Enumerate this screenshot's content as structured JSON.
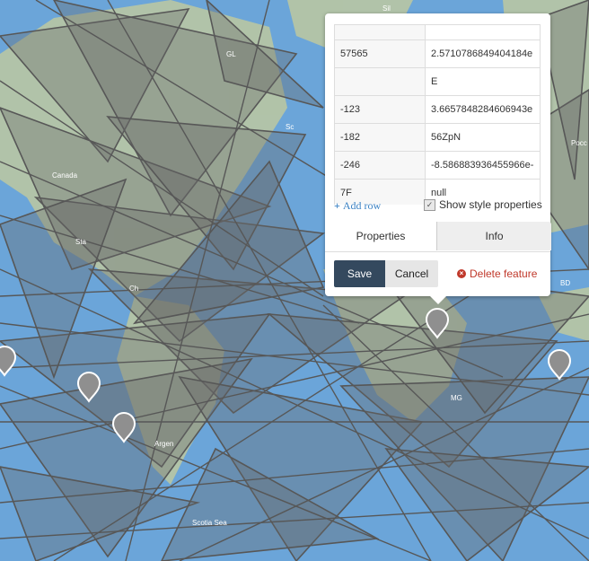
{
  "properties_table": {
    "rows": [
      {
        "key": "",
        "value": ""
      },
      {
        "key": "57565",
        "value": "2.5710786849404184e"
      },
      {
        "key": "",
        "value": "E"
      },
      {
        "key": "-123",
        "value": "3.6657848284606943e"
      },
      {
        "key": "-182",
        "value": "56ZpN"
      },
      {
        "key": "-246",
        "value": "-8.586883936455966e-"
      },
      {
        "key": "7F",
        "value": "null"
      }
    ]
  },
  "actions": {
    "add_row_label": "Add row",
    "show_style_label": "Show style properties",
    "show_style_checked": true
  },
  "tabs": [
    {
      "label": "Properties",
      "active": true
    },
    {
      "label": "Info",
      "active": false
    }
  ],
  "buttons": {
    "save": "Save",
    "cancel": "Cancel",
    "delete": "Delete feature"
  },
  "colors": {
    "accent": "#34495e",
    "link": "#3c83c5",
    "danger": "#c0392b",
    "polygon_stroke": "#5a5a5a"
  },
  "map": {
    "labels": [
      "Sil",
      "Canada",
      "Sta",
      "Sc",
      "GL",
      "MG",
      "Argen",
      "Scotia Sea",
      "BD",
      "Pocc",
      "Ch"
    ]
  }
}
